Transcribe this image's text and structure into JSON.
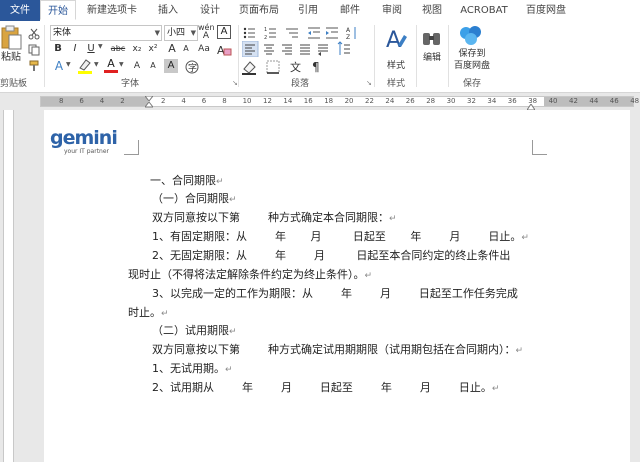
{
  "tabs": {
    "file": "文件",
    "home": "开始",
    "new_tab": "新建选项卡",
    "insert": "插入",
    "design": "设计",
    "page_layout": "页面布局",
    "references": "引用",
    "mailings": "邮件",
    "review": "审阅",
    "view": "视图",
    "acrobat": "ACROBAT",
    "baidu": "百度网盘"
  },
  "ribbon": {
    "paste": "粘贴",
    "clipboard_label": "剪贴板",
    "font_name": "宋体",
    "font_size": "小四",
    "font_label": "字体",
    "paragraph_label": "段落",
    "styles": "样式",
    "styles_label": "样式",
    "editing": "编辑",
    "save_to": "保存到",
    "baidu_pan": "百度网盘",
    "save_label": "保存",
    "wen": "wén",
    "a_glyph": "A",
    "bold": "B",
    "italic": "I",
    "underline": "U",
    "strike": "abc",
    "subscript": "x₂",
    "superscript": "x²",
    "grow": "A",
    "shrink": "A",
    "aa": "Aa",
    "clear": "A",
    "text_effects": "A",
    "highlight": "ab",
    "font_color": "A",
    "char_shading": "A",
    "char_border": "A"
  },
  "ruler": {
    "numbers": [
      "8",
      "6",
      "4",
      "2",
      "",
      "2",
      "4",
      "6",
      "8",
      "10",
      "12",
      "14",
      "16",
      "18",
      "20",
      "22",
      "24",
      "26",
      "28",
      "30",
      "32",
      "34",
      "36",
      "38",
      "40",
      "42",
      "44",
      "46",
      "48"
    ]
  },
  "logo": {
    "name": "gemini",
    "tagline": "your IT partner"
  },
  "document": {
    "lines": [
      "一、合同期限",
      "（一）合同期限",
      "双方同意按以下第        种方式确定本合同期限：",
      "1、有固定期限：从        年       月         日起至       年        月        日止。",
      "2、无固定期限：从        年        月         日起至本合同约定的终止条件出",
      "现时止（不得将法定解除条件约定为终止条件）。",
      "3、以完成一定的工作为期限：从        年        月        日起至工作任务完成",
      "时止。",
      "（二）试用期限",
      "双方同意按以下第        种方式确定试用期期限（试用期包括在合同期内）：",
      "1、无试用期。",
      "2、试用期从        年        月        日起至        年        月        日止。"
    ],
    "para_mark": "↵"
  }
}
